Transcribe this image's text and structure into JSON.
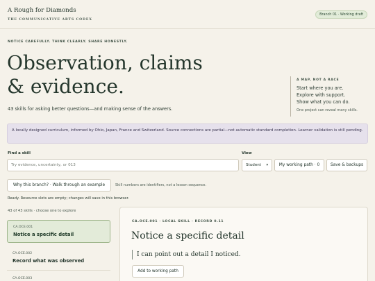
{
  "header": {
    "title": "A Rough for Diamonds",
    "subtitle": "THE COMMUNICATIVE ARTS CODEX",
    "branch_badge": "Branch 01 · Working draft"
  },
  "hero": {
    "kicker": "NOTICE CAREFULLY. THINK CLEARLY. SHARE HONESTLY.",
    "title_line1": "Observation, claims",
    "title_line2": "& evidence.",
    "subtitle": "43 skills for asking better questions—and making sense of the answers."
  },
  "aside": {
    "title": "A MAP, NOT A RACE",
    "lines": [
      "Start where you are.",
      "Explore with support.",
      "Show what you can do."
    ],
    "note": "One project can reveal many skills."
  },
  "notice": "A locally designed curriculum, informed by Ohio, Japan, France and Switzerland. Source connections are partial—not automatic standard completion. Learner validation is still pending.",
  "controls": {
    "find_label": "Find a skill",
    "search_placeholder": "Try evidence, uncertainty, or 013",
    "view_label": "View",
    "view_selected": "Student",
    "working_path_button": "My working path · 0",
    "save_button": "Save & backups",
    "why_button": "Why this branch? · Walk through an example",
    "skill_note": "Skill numbers are identifiers, not a lesson sequence."
  },
  "status": "Ready. Resource slots are empty; changes will save in this browser.",
  "list": {
    "count": "43 of 43 skills · choose one to explore",
    "items": [
      {
        "code": "CA.OCE.001",
        "name": "Notice a specific detail",
        "selected": true
      },
      {
        "code": "CA.OCE.002",
        "name": "Record what was observed",
        "selected": false
      },
      {
        "code": "CA.OCE.003",
        "name": "",
        "selected": false
      }
    ]
  },
  "detail": {
    "meta": "CA.OCE.001 · LOCAL SKILL · RECORD 0.11",
    "title": "Notice a specific detail",
    "quote": "I can point out a detail I noticed.",
    "add_button": "Add to working path"
  },
  "icons": {
    "select_caret": "chevron-down-icon"
  },
  "colors": {
    "background": "#f5f2ea",
    "text": "#24362c",
    "selected_bg": "#e3ebd9",
    "notice_bg": "#e6e1ec"
  }
}
